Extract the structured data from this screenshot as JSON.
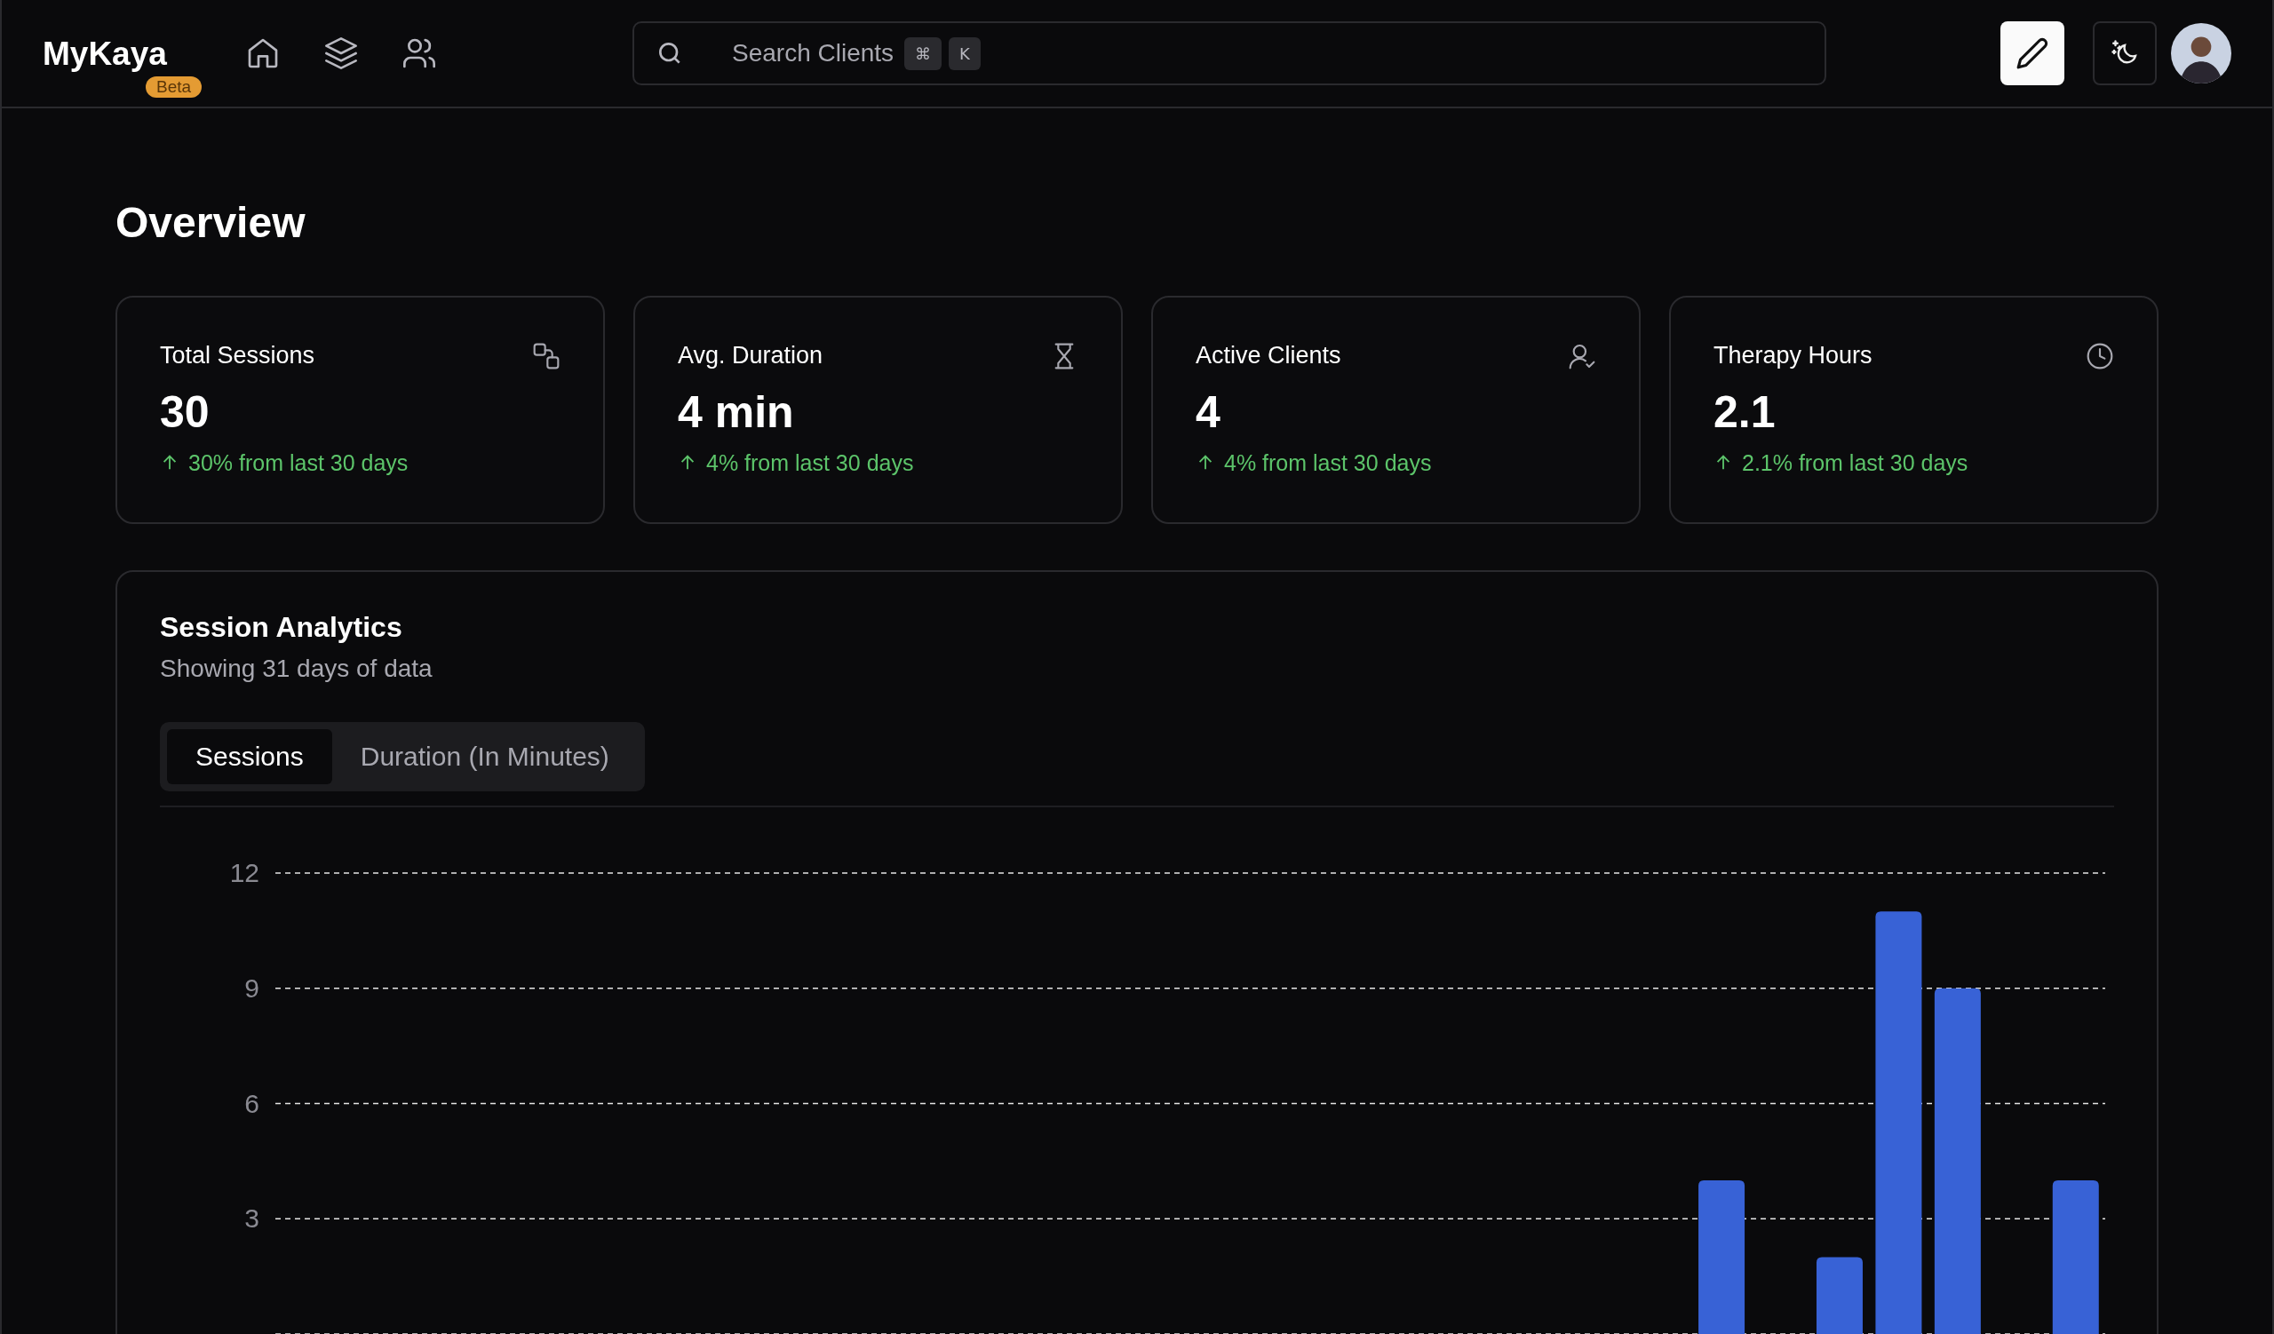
{
  "header": {
    "logo": "MyKaya",
    "badge": "Beta",
    "search": {
      "placeholder": "Search Clients",
      "keys": [
        "⌘",
        "K"
      ]
    }
  },
  "page_title": "Overview",
  "cards": [
    {
      "kind": "sessions",
      "title": "Total Sessions",
      "value": "30",
      "delta": "30% from last 30 days"
    },
    {
      "kind": "duration",
      "title": "Avg. Duration",
      "value": "4 min",
      "delta": "4% from last 30 days"
    },
    {
      "kind": "clients",
      "title": "Active Clients",
      "value": "4",
      "delta": "4% from last 30 days"
    },
    {
      "kind": "hours",
      "title": "Therapy Hours",
      "value": "2.1",
      "delta": "2.1% from last 30 days"
    }
  ],
  "analytics": {
    "title": "Session Analytics",
    "subtitle": "Showing 31 days of data",
    "tabs": [
      {
        "label": "Sessions",
        "selected": true
      },
      {
        "label": "Duration (In Minutes)",
        "selected": false
      }
    ],
    "chart_data": {
      "type": "bar",
      "grid": true,
      "ylim": [
        0,
        12
      ],
      "yticks": [
        3,
        6,
        9,
        12
      ],
      "series": [
        {
          "color": "#3862d6",
          "values": [
            0,
            0,
            0,
            0,
            0,
            0,
            0,
            0,
            0,
            0,
            0,
            0,
            0,
            0,
            0,
            0,
            0,
            0,
            0,
            0,
            0,
            0,
            0,
            0,
            4,
            0,
            2,
            11,
            9,
            0,
            4
          ]
        }
      ]
    }
  }
}
